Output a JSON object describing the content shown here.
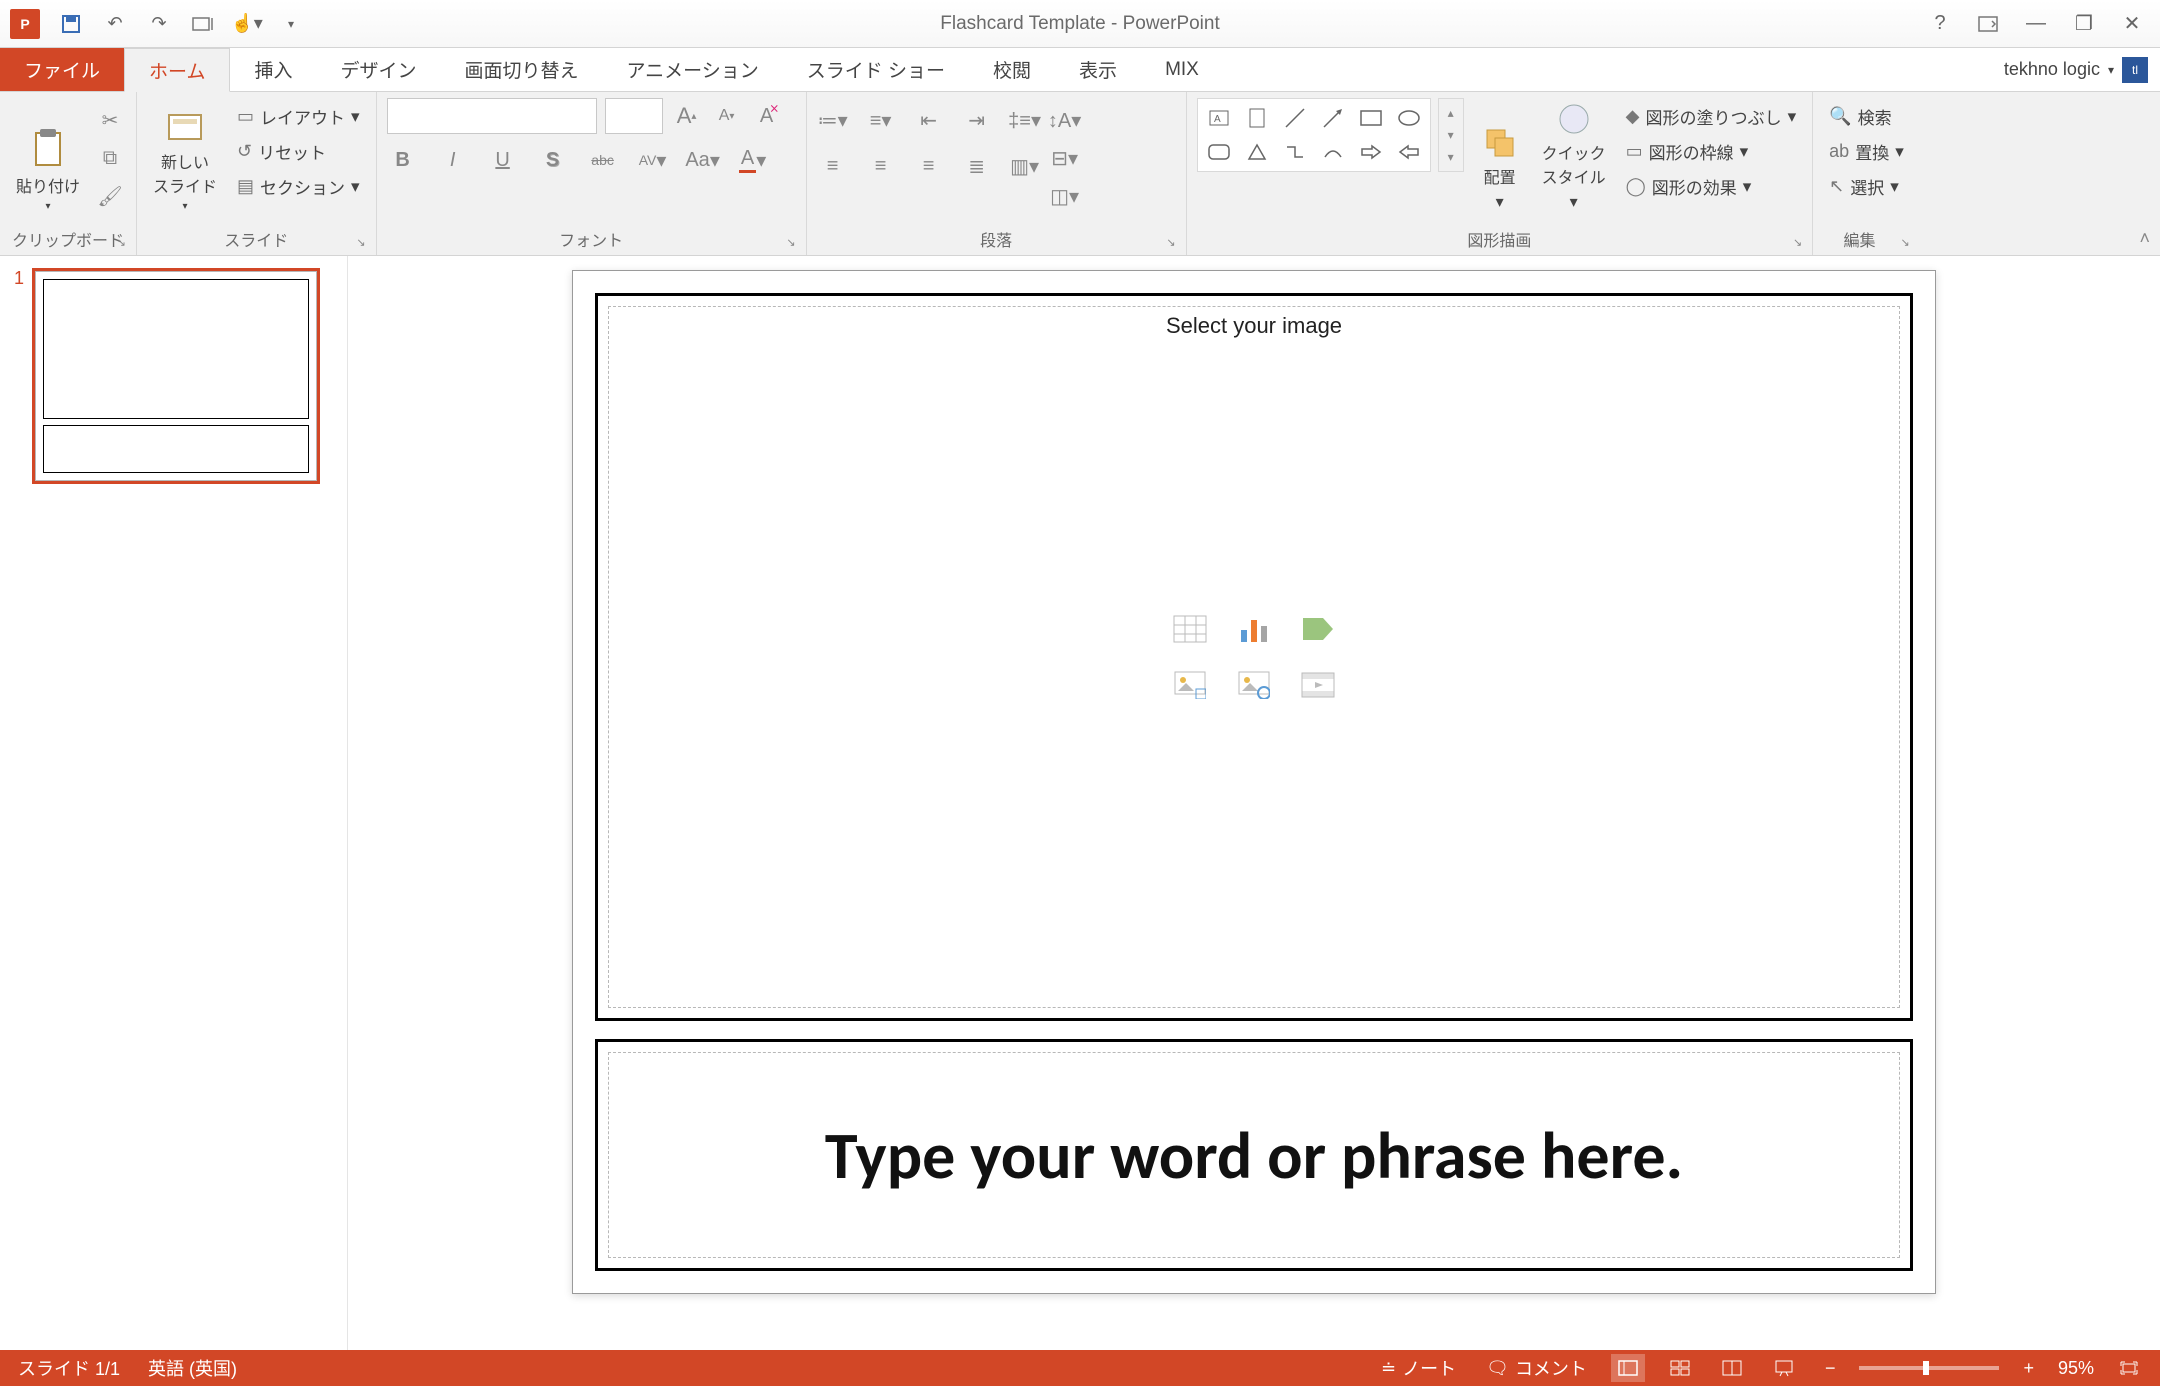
{
  "window": {
    "title": "Flashcard Template - PowerPoint",
    "account_name": "tekhno logic",
    "account_initials": "tl"
  },
  "qat": {
    "app": "P",
    "save": "💾",
    "undo": "↶",
    "redo": "↷",
    "from_beginning": "⎚",
    "touch": "☝"
  },
  "winctrl": {
    "help": "?",
    "ribbon_opts": "▭",
    "minimize": "—",
    "restore": "❐",
    "close": "✕"
  },
  "tabs": {
    "file": "ファイル",
    "home": "ホーム",
    "insert": "挿入",
    "design": "デザイン",
    "transitions": "画面切り替え",
    "animations": "アニメーション",
    "slideshow": "スライド ショー",
    "review": "校閲",
    "view": "表示",
    "mix": "MIX"
  },
  "ribbon": {
    "clipboard": {
      "label": "クリップボード",
      "paste": "貼り付け",
      "cut": "✂",
      "copy": "⧉",
      "painter": "🖌"
    },
    "slides": {
      "label": "スライド",
      "new_slide": "新しい\nスライド",
      "layout": "レイアウト",
      "reset": "リセット",
      "section": "セクション"
    },
    "font": {
      "label": "フォント",
      "bold": "B",
      "italic": "I",
      "underline": "U",
      "shadow": "S",
      "strike": "abc",
      "spacing": "AV",
      "case": "Aa",
      "color": "A",
      "grow": "A",
      "shrink": "A",
      "clear": "A"
    },
    "paragraph": {
      "label": "段落"
    },
    "drawing": {
      "label": "図形描画",
      "arrange": "配置",
      "quick_styles": "クイック\nスタイル",
      "shape_fill": "図形の塗りつぶし",
      "shape_outline": "図形の枠線",
      "shape_effects": "図形の効果"
    },
    "editing": {
      "label": "編集",
      "find": "検索",
      "replace": "置換",
      "select": "選択"
    }
  },
  "thumbs": {
    "slide1_num": "1"
  },
  "slide": {
    "image_placeholder": "Select your image",
    "text_placeholder": "Type your word or phrase here."
  },
  "statusbar": {
    "slide_info": "スライド 1/1",
    "language": "英語 (英国)",
    "notes": "ノート",
    "comments": "コメント",
    "zoom": "95%"
  }
}
